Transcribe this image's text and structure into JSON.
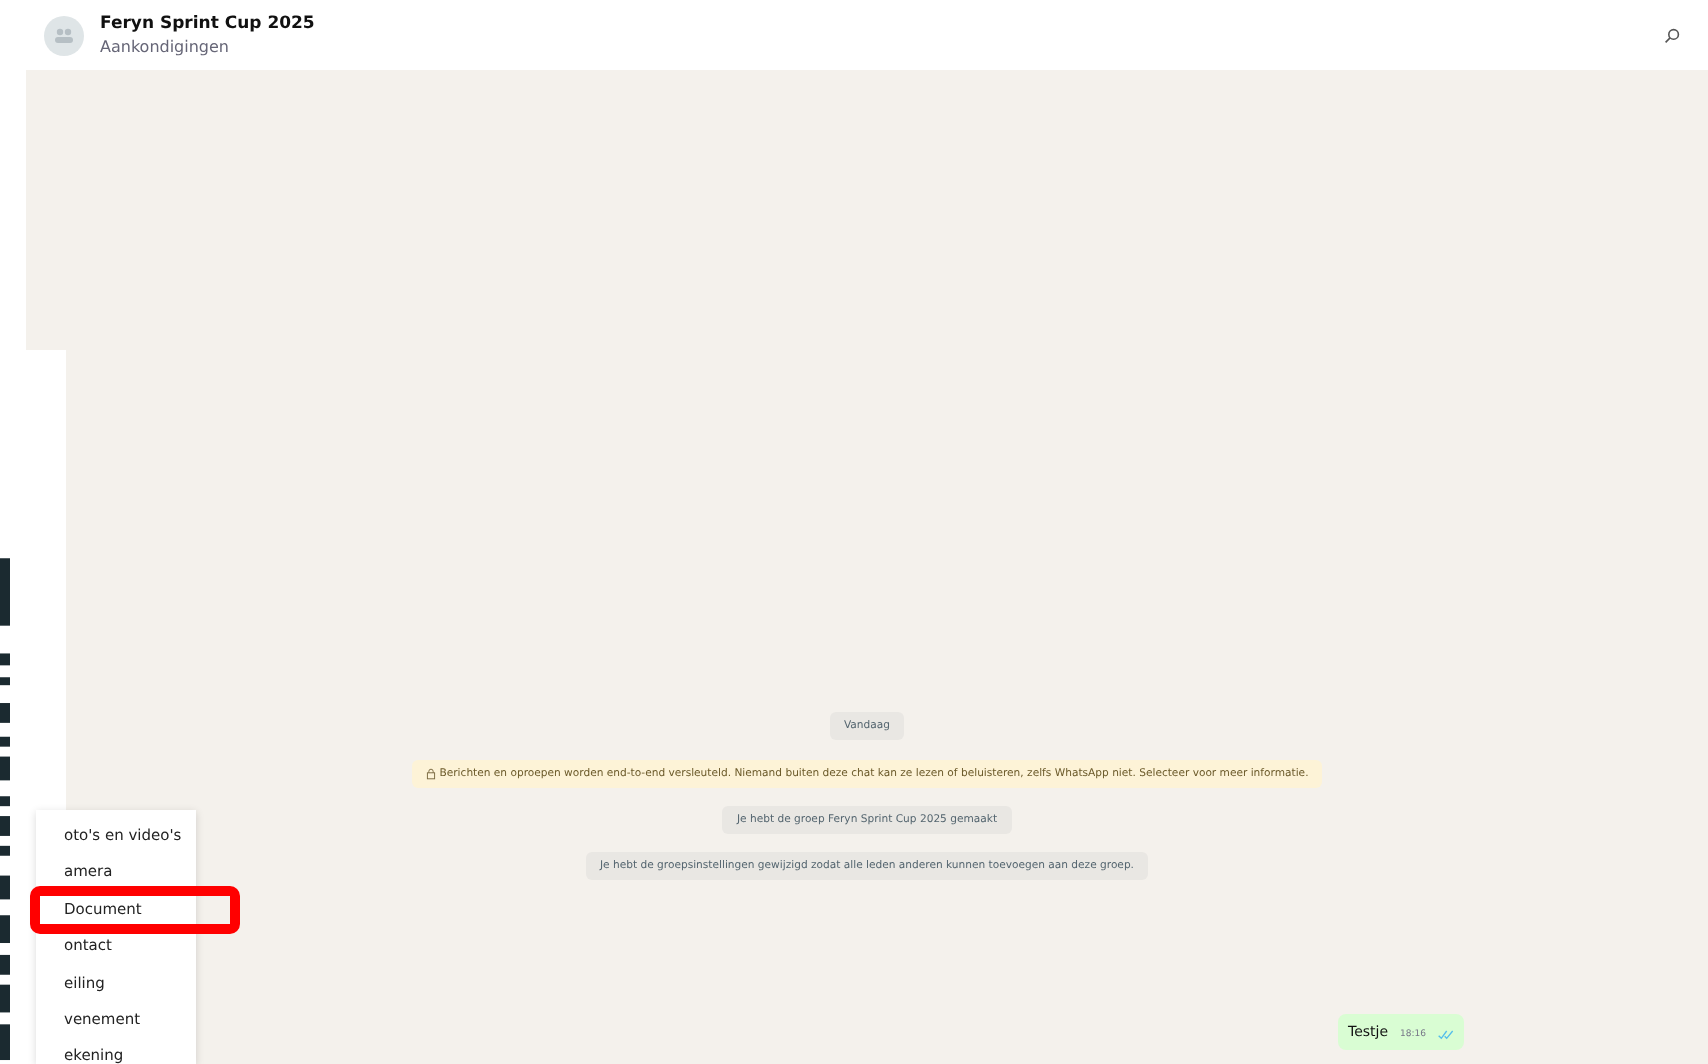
{
  "header": {
    "title": "Feryn Sprint Cup 2025",
    "subtitle": "Aankondigingen"
  },
  "messages": [
    {
      "kind": "date",
      "text": "Vandaag"
    },
    {
      "kind": "notice",
      "text": "Berichten en oproepen worden end-to-end versleuteld. Niemand buiten deze chat kan ze lezen of beluisteren, zelfs WhatsApp niet. Selecteer voor meer informatie."
    },
    {
      "kind": "system",
      "text": "Je hebt de groep Feryn Sprint Cup 2025 gemaakt"
    },
    {
      "kind": "system",
      "text": "Je hebt de groepsinstellingen gewijzigd zodat alle leden anderen kunnen toevoegen aan deze groep."
    },
    {
      "kind": "outgoing",
      "text": "Testje",
      "time": "18:16",
      "read": true
    }
  ],
  "attach_menu": [
    {
      "label": "oto's en video's",
      "highlighted": false
    },
    {
      "label": "amera",
      "highlighted": false
    },
    {
      "label": "Document",
      "highlighted": true
    },
    {
      "label": "ontact",
      "highlighted": false
    },
    {
      "label": "eiling",
      "highlighted": false
    },
    {
      "label": "venement",
      "highlighted": false
    },
    {
      "label": "ekening",
      "highlighted": false
    }
  ]
}
